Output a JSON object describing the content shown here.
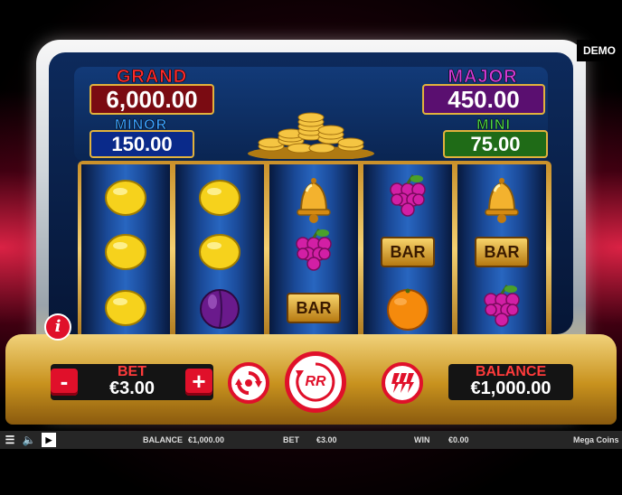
{
  "badge": {
    "demo": "DEMO"
  },
  "jackpots": {
    "grand": {
      "label": "GRAND",
      "value": "6,000.00"
    },
    "major": {
      "label": "MAJOR",
      "value": "450.00"
    },
    "minor": {
      "label": "MINOR",
      "value": "150.00"
    },
    "mini": {
      "label": "MINI",
      "value": "75.00"
    }
  },
  "reels": [
    [
      "lemon",
      "lemon",
      "lemon"
    ],
    [
      "lemon",
      "lemon",
      "plum"
    ],
    [
      "bell",
      "grapes",
      "bar"
    ],
    [
      "grapes",
      "bar",
      "orange"
    ],
    [
      "bell",
      "bar",
      "grapes"
    ]
  ],
  "symbols": {
    "bar": "BAR"
  },
  "controls": {
    "bet_label": "BET",
    "bet_value": "€3.00",
    "minus": "-",
    "plus": "+",
    "balance_label": "BALANCE",
    "balance_value": "€1,000.00",
    "spin_logo": "RR",
    "info": "i"
  },
  "icons": {
    "autoplay": "autoplay-icon",
    "spin": "spin-icon",
    "turbo": "turbo-icon",
    "menu": "menu-icon",
    "sound": "sound-icon",
    "video": "video-icon"
  },
  "status_bar": {
    "balance_label": "BALANCE",
    "balance_value": "€1,000.00",
    "bet_label": "BET",
    "bet_value": "€3.00",
    "win_label": "WIN",
    "win_value": "€0.00",
    "game_name": "Mega Coins"
  },
  "colors": {
    "accent": "#e0102a",
    "gold": "#e2b23c",
    "grand": "#ff2a2a",
    "major": "#d13bd6",
    "minor": "#3aa0ff",
    "mini": "#4ed648"
  }
}
